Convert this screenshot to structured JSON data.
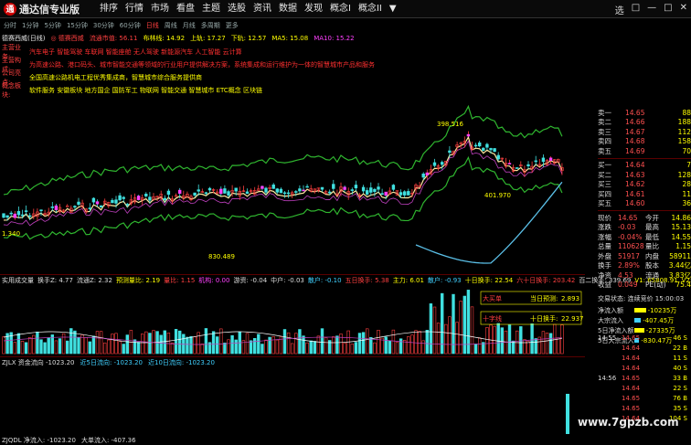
{
  "app": {
    "logo_mark": "通",
    "title": "通达信专业版"
  },
  "menu": [
    "排序",
    "行情",
    "市场",
    "看盘",
    "主题",
    "选股",
    "资讯",
    "数据",
    "发现",
    "概念I",
    "概念II",
    "▼"
  ],
  "window_buttons": [
    "选",
    "□",
    "—",
    "□",
    "✕"
  ],
  "periods": [
    "分时",
    "1分钟",
    "5分钟",
    "15分钟",
    "30分钟",
    "60分钟",
    "日线",
    "周线",
    "月线",
    "多周期",
    "更多"
  ],
  "active_period": "日线",
  "info": {
    "name": "德赛西威(日线)",
    "badge": "◎ 德赛西威",
    "items": [
      "流通市值: 56.11",
      "布林线: 14.92",
      "上轨: 17.27",
      "下轨: 12.57",
      "MA5: 15.08",
      "MA10: 15.22"
    ]
  },
  "info_rows": [
    {
      "label": "主营业务:",
      "value": "汽车电子 智能驾驶 车联网 智能座舱 无人驾驶 新能源汽车 人工智能 云计算",
      "color": "red"
    },
    {
      "label": "主营构成:",
      "value": "为高速公路、港口码头、城市智能交通等领域的行业用户提供解决方案，系统集成和运行维护为一体的智慧城市产品和服务",
      "color": "red"
    },
    {
      "label": "公司亮点:",
      "value": "全国高速公路机电工程优秀集成商，智慧城市综合服务提供商",
      "color": "yellow"
    },
    {
      "label": "概念板块:",
      "value": "软件服务 安徽板块 地方国企 国防军工 物联网 智能交通 智慧城市 ETC概念 区块链",
      "color": "yellow"
    }
  ],
  "main_chart": {
    "labels": [
      {
        "text": "1.340",
        "color": "#ffff00"
      },
      {
        "text": "830.489",
        "color": "#ffff00"
      },
      {
        "text": "398.516",
        "color": "#ffff00"
      },
      {
        "text": "401.970",
        "color": "#ffff00"
      }
    ]
  },
  "vol_panel": {
    "title_items": [
      {
        "text": "实用成交量",
        "color": "#ddd"
      },
      {
        "text": "换手Z: 4.77",
        "color": "#ddd"
      },
      {
        "text": "流通Z: 2.32",
        "color": "#ddd"
      },
      {
        "text": "预测量比: 2.19",
        "color": "#ffff00"
      },
      {
        "text": "量比: 1.15",
        "color": "#ff4040"
      },
      {
        "text": "机构: 0.00",
        "color": "#ff40ff"
      },
      {
        "text": "游资: -0.04",
        "color": "#ddd"
      },
      {
        "text": "中户: -0.03",
        "color": "#ddd"
      },
      {
        "text": "散户: -0.10",
        "color": "#40d0ff"
      },
      {
        "text": "五日换手: 5.38",
        "color": "#ff4040"
      },
      {
        "text": "主力: 6.01",
        "color": "#ffff00"
      },
      {
        "text": "散户: -0.93",
        "color": "#40d0ff"
      },
      {
        "text": "十日换手: 22.54",
        "color": "#ffff00"
      },
      {
        "text": "六十日换手: 203.42",
        "color": "#ff4040"
      },
      {
        "text": "百二换手: 339.69",
        "color": "#ddd"
      },
      {
        "text": "V1: 65808.91",
        "color": "#ffff00"
      },
      {
        "text": "V2: 67855.31",
        "color": "#ffff00"
      }
    ],
    "boxes": [
      {
        "label": "大买单",
        "value": "当日预测:",
        "value2": "2.893"
      },
      {
        "label": "十字线",
        "value": "十日换手:",
        "value2": "22.937"
      }
    ]
  },
  "zj_panel": {
    "title_items": [
      {
        "text": "ZJLX 资金流向 -1023.20",
        "color": "#ddd"
      },
      {
        "text": "近5日流向: -1023.20",
        "color": "#40d0ff"
      },
      {
        "text": "近10日流向: -1023.20",
        "color": "#40d0ff"
      }
    ]
  },
  "quote": {
    "sell": [
      [
        "卖一",
        "14.65",
        "88"
      ],
      [
        "卖二",
        "14.66",
        "188"
      ],
      [
        "卖三",
        "14.67",
        "112"
      ],
      [
        "卖四",
        "14.68",
        "158"
      ],
      [
        "卖五",
        "14.69",
        "70"
      ]
    ],
    "buy": [
      [
        "买一",
        "14.64",
        "7"
      ],
      [
        "买二",
        "14.63",
        "128"
      ],
      [
        "买三",
        "14.62",
        "28"
      ],
      [
        "买四",
        "14.61",
        "11"
      ],
      [
        "买五",
        "14.60",
        "36"
      ]
    ],
    "stats": [
      [
        "现价",
        "14.65",
        "今开",
        "14.86"
      ],
      [
        "涨跌",
        "-0.03",
        "最高",
        "15.13"
      ],
      [
        "涨幅",
        "-0.04%",
        "最低",
        "14.55"
      ],
      [
        "总量",
        "110628",
        "量比",
        "1.15"
      ],
      [
        "外盘",
        "51917",
        "内盘",
        "58911"
      ],
      [
        "换手",
        "2.89%",
        "股本",
        "3.44亿"
      ],
      [
        "净资",
        "4.53",
        "流通",
        "3.83亿"
      ],
      [
        "收益",
        "0.049",
        "PE(动)",
        "75.4"
      ]
    ]
  },
  "status": {
    "head": "交易状态: 连续竞价 15:00:03",
    "rows": [
      {
        "label": "净流入额",
        "value": "-10235万",
        "bar_color": "#ffff00",
        "bar_pct": 0.7
      },
      {
        "label": "大宗流入",
        "value": "-407.45万",
        "bar_color": "#40d0ff",
        "bar_pct": 0.4
      },
      {
        "label": "5日净流入额",
        "value": "-27335万",
        "bar_color": "#ffff00",
        "bar_pct": 0.6
      },
      {
        "label": "5日大宗流入",
        "value": "-830.47万",
        "bar_color": "#40d0ff",
        "bar_pct": 0.3
      }
    ]
  },
  "ticks": [
    [
      "14:55",
      "14.65",
      "46 S"
    ],
    [
      "",
      "14.64",
      "22 B"
    ],
    [
      "",
      "14.64",
      "11 S"
    ],
    [
      "",
      "14.64",
      "40 S"
    ],
    [
      "14:56",
      "14.65",
      "33 B"
    ],
    [
      "",
      "14.64",
      "22 S"
    ],
    [
      "",
      "14.65",
      "76 B"
    ],
    [
      "",
      "14.65",
      "35 S"
    ],
    [
      "",
      "14.64",
      "104 S"
    ]
  ],
  "bottom": [
    "ZJQDL 净流入: -1023.20",
    "大单流入: -407.36"
  ],
  "watermark": "www.7gpzb.com"
}
